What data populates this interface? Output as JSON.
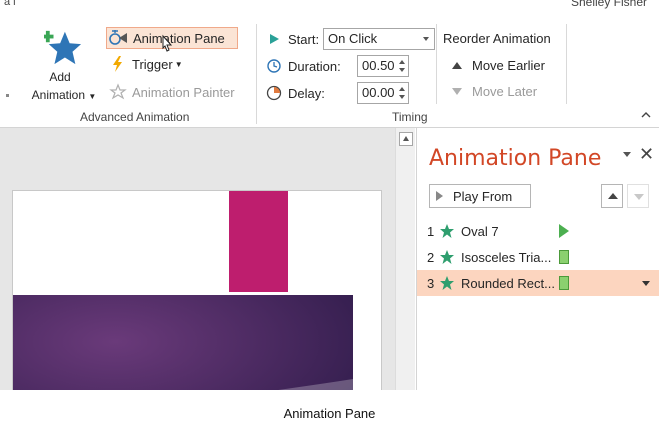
{
  "header": {
    "top_left_text": "a l",
    "user_name": "Shelley Fisher"
  },
  "advanced_animation": {
    "add_animation_label_line1": "Add",
    "add_animation_label_line2": "Animation",
    "animation_pane_label": "Animation Pane",
    "trigger_label": "Trigger",
    "animation_painter_label": "Animation Painter",
    "group_label": "Advanced Animation"
  },
  "timing": {
    "start_label": "Start:",
    "start_value": "On Click",
    "duration_label": "Duration:",
    "duration_value": "00.50",
    "delay_label": "Delay:",
    "delay_value": "00.00",
    "reorder_title": "Reorder Animation",
    "move_earlier_label": "Move Earlier",
    "move_later_label": "Move Later",
    "group_label": "Timing"
  },
  "pane": {
    "title": "Animation Pane",
    "play_from_label": "Play From",
    "items": [
      {
        "number": "1",
        "name": "Oval 7",
        "marker": "triangle"
      },
      {
        "number": "2",
        "name": "Isosceles Tria...",
        "marker": "box"
      },
      {
        "number": "3",
        "name": "Rounded Rect...",
        "marker": "box"
      }
    ]
  },
  "caption": "Animation Pane",
  "colors": {
    "accent": "#d24726",
    "selected_bg": "#fcd5bf",
    "star_green": "#2e9e6e",
    "slide_pink": "#be1e6e",
    "slide_purple": "#3c1e5a"
  }
}
